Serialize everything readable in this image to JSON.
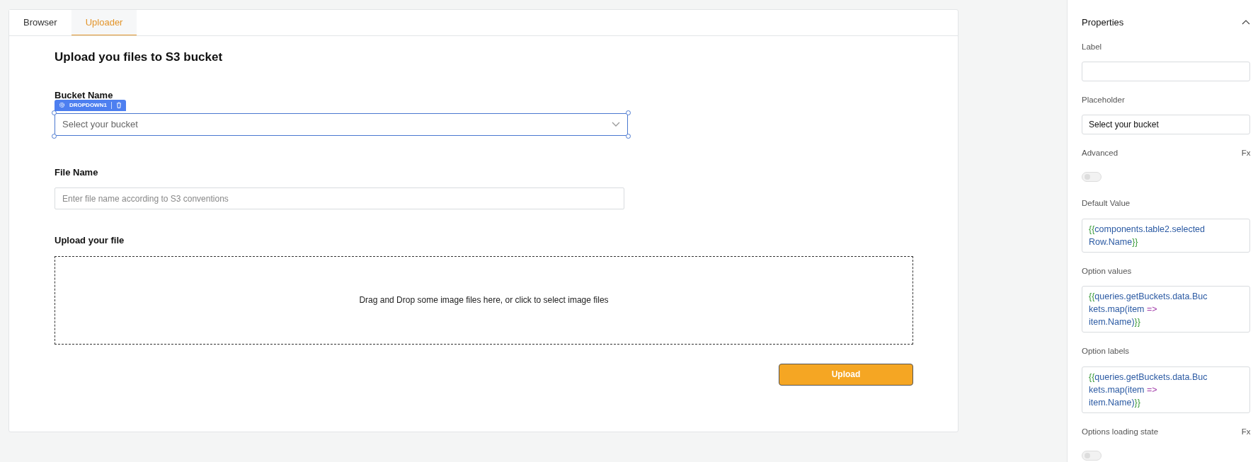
{
  "tabs": [
    {
      "label": "Browser",
      "selected": false
    },
    {
      "label": "Uploader",
      "selected": true
    }
  ],
  "form": {
    "title": "Upload you files to S3 bucket",
    "bucket": {
      "label": "Bucket Name",
      "placeholder": "Select your bucket",
      "widget_tag": "DROPDOWN1",
      "selected": true
    },
    "file_name": {
      "label": "File Name",
      "placeholder": "Enter file name according to S3 conventions"
    },
    "upload": {
      "label": "Upload your file",
      "dropzone_text": "Drag and Drop some image files here, or click to select image files"
    },
    "button": "Upload"
  },
  "properties": {
    "title": "Properties",
    "expanded": true,
    "fields": [
      {
        "kind": "input",
        "label": "Label"
      },
      {
        "kind": "input",
        "label": "Placeholder",
        "value": "Select your bucket"
      },
      {
        "kind": "toggle",
        "label": "Advanced",
        "fx": "Fx",
        "on": false
      },
      {
        "kind": "code",
        "label": "Default Value",
        "segments": [
          {
            "kind": "brace",
            "text": "{{"
          },
          {
            "kind": "ident",
            "text": "components.table2.selected Row.Name"
          },
          {
            "kind": "brace",
            "text": "}}"
          }
        ]
      },
      {
        "kind": "code",
        "label": "Option values",
        "segments": [
          {
            "kind": "brace",
            "text": "{{"
          },
          {
            "kind": "ident",
            "text": "queries.getBuckets.data.Buc kets.map(item "
          },
          {
            "kind": "op",
            "text": "=>"
          },
          {
            "kind": "ident",
            "text": " item.Name)"
          },
          {
            "kind": "brace",
            "text": "}}"
          }
        ]
      },
      {
        "kind": "code",
        "label": "Option labels",
        "segments": [
          {
            "kind": "brace",
            "text": "{{"
          },
          {
            "kind": "ident",
            "text": "queries.getBuckets.data.Buc kets.map(item "
          },
          {
            "kind": "op",
            "text": "=>"
          },
          {
            "kind": "ident",
            "text": " item.Name)"
          },
          {
            "kind": "brace",
            "text": "}}"
          }
        ]
      },
      {
        "kind": "toggle",
        "label": "Options loading state",
        "fx": "Fx",
        "on": false
      }
    ]
  }
}
